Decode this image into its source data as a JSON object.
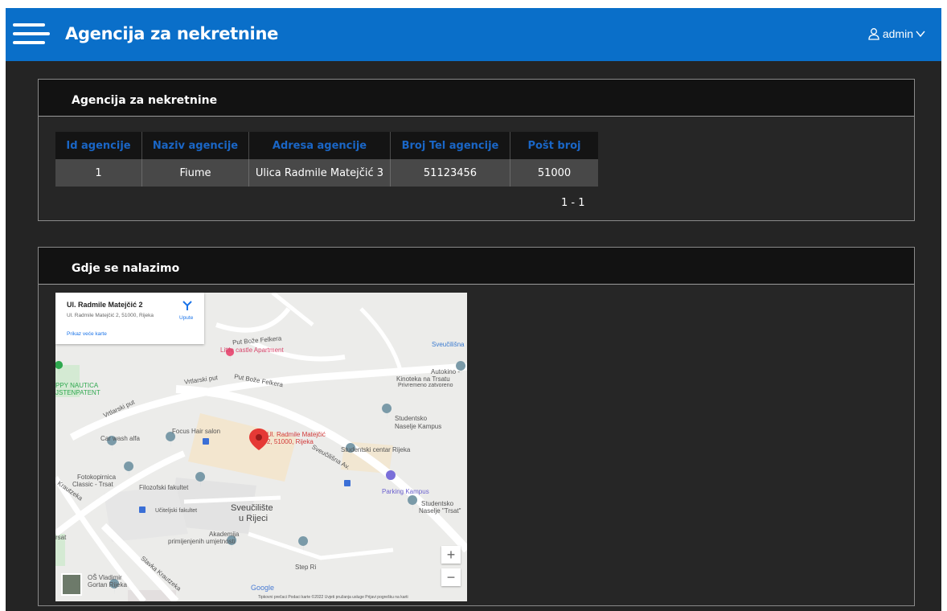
{
  "header": {
    "title": "Agencija za nekretnine",
    "user": "admin",
    "menu_icon": "hamburger-menu-icon",
    "user_icon": "user-icon",
    "dropdown_icon": "chevron-down-icon"
  },
  "agency_panel": {
    "title": "Agencija za nekretnine",
    "columns": [
      "Id agencije",
      "Naziv agencije",
      "Adresa agencije",
      "Broj Tel agencije",
      "Pošt broj"
    ],
    "rows": [
      [
        "1",
        "Fiume",
        "Ulica Radmile Matejčić 3",
        "51123456",
        "51000"
      ]
    ],
    "pagination": "1 - 1"
  },
  "map_panel": {
    "title": "Gdje se nalazimo",
    "card": {
      "place_name": "Ul. Radmile Matejčić 2",
      "place_address": "Ul. Radmile Matejčić 2, 51000, Rijeka",
      "directions": "Upute",
      "larger_map": "Prikaz veće karte"
    },
    "marker_label_1": "Ul. Radmile Matejčić",
    "marker_label_2": "2, 51000, Rijeka",
    "labels": {
      "put_bozne_1": "Put Bože Felkera",
      "put_bozne_2": "Put Bože Felkera",
      "little_castle": "Little castle Apartment",
      "vrtlarski": "Vrtlarski put",
      "vrtlarski2": "Vrtlarski put",
      "sveucilisna_top": "Sveučilišna",
      "autokino_1": "Autokino -",
      "autokino_2": "Kinoteka na Trsatu",
      "autokino_3": "Privremeno zatvoreno",
      "nautica_1": "PPY NAUTICA",
      "nautica_2": "JSTENPATENT",
      "studentsko_1": "Studentsko",
      "studentsko_2": "Naselje Kampus",
      "focus": "Focus Hair salon",
      "car_wash": "Car wash alfa",
      "studentski_centar": "Studentski centar Rijeka",
      "sveucilisna_av": "Sveučilišna Av.",
      "fotokopirnica_1": "Fotokopirnica",
      "fotokopirnica_2": "Classic - Trsat",
      "filozofski": "Filozofski fakultet",
      "parking": "Parking Kampus",
      "studentsko_trsat_1": "Studentsko",
      "studentsko_trsat_2": "Naselje \"Trsat\"",
      "ucitelj": "Učiteljski fakultet",
      "sveuciliste_1": "Sveučilište",
      "sveuciliste_2": "u Rijeci",
      "akademija_1": "Akademija",
      "akademija_2": "primijenjenih umjetnosti",
      "step": "Step Ri",
      "os_1": "OŠ Vladimir",
      "os_2": "Gortan Rijeka",
      "krautzeka": "Krautzeka",
      "slavka": "Slavka Krautzeka",
      "trsat": "rsat",
      "google": "Google",
      "footer": "Tipkovni prečaci   Podaci karte ©2022   Uvjeti pružanja usluge   Prijavi pogrešku na karti",
      "zoom_in": "+",
      "zoom_out": "−"
    }
  }
}
